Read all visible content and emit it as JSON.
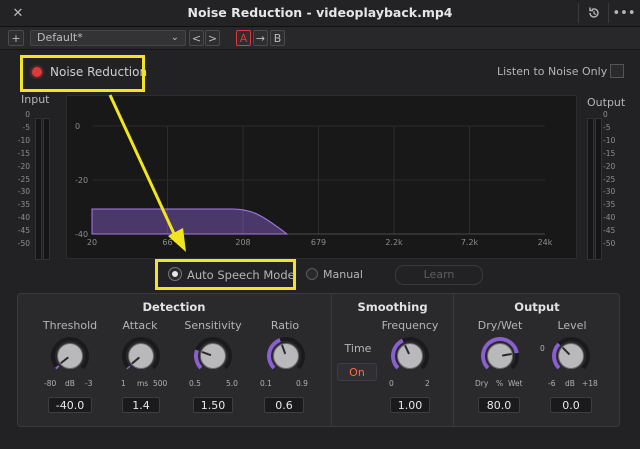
{
  "window": {
    "title": "Noise Reduction - videoplayback.mp4"
  },
  "presetbar": {
    "add": "+",
    "preset": "Default*",
    "prev": "<",
    "next": ">",
    "a": "A",
    "copy": "→",
    "b": "B"
  },
  "top": {
    "enable_label": "Noise Reduction",
    "listen_label": "Listen to Noise Only",
    "input_label": "Input",
    "output_label": "Output"
  },
  "meter_scale": [
    "0",
    "-5",
    "-10",
    "-15",
    "-20",
    "-25",
    "-30",
    "-35",
    "-40",
    "-45",
    "-50"
  ],
  "graph": {
    "y_ticks": [
      "0",
      "-20",
      "-40"
    ],
    "x_ticks": [
      "20",
      "66",
      "208",
      "679",
      "2.2k",
      "7.2k",
      "24k"
    ],
    "accent": "#8a5fd0"
  },
  "mode": {
    "auto": "Auto Speech Mode",
    "manual": "Manual",
    "learn": "Learn"
  },
  "detection": {
    "title": "Detection",
    "threshold": {
      "label": "Threshold",
      "min": "-80",
      "unit": "dB",
      "max": "-3",
      "value": "-40.0"
    },
    "attack": {
      "label": "Attack",
      "min": "1",
      "unit": "ms",
      "max": "500",
      "value": "1.4"
    },
    "sensitivity": {
      "label": "Sensitivity",
      "min": "0.5",
      "max": "5.0",
      "value": "1.50"
    },
    "ratio": {
      "label": "Ratio",
      "min": "0.1",
      "max": "0.9",
      "value": "0.6"
    }
  },
  "smoothing": {
    "title": "Smoothing",
    "time_label": "Time",
    "time_toggle": "On",
    "frequency": {
      "label": "Frequency",
      "min": "0",
      "max": "2",
      "value": "1.00"
    }
  },
  "output": {
    "title": "Output",
    "drywet": {
      "label": "Dry/Wet",
      "min": "Dry",
      "unit": "%",
      "max": "Wet",
      "value": "80.0"
    },
    "level": {
      "label": "Level",
      "zero": "0",
      "min": "-6",
      "unit": "dB",
      "max": "+18",
      "value": "0.0"
    }
  },
  "colors": {
    "highlight": "#f1e51f",
    "led_on": "#e0393c",
    "toggle_on": "#ff6a3d",
    "knob_arc": "#8a5fd0"
  }
}
